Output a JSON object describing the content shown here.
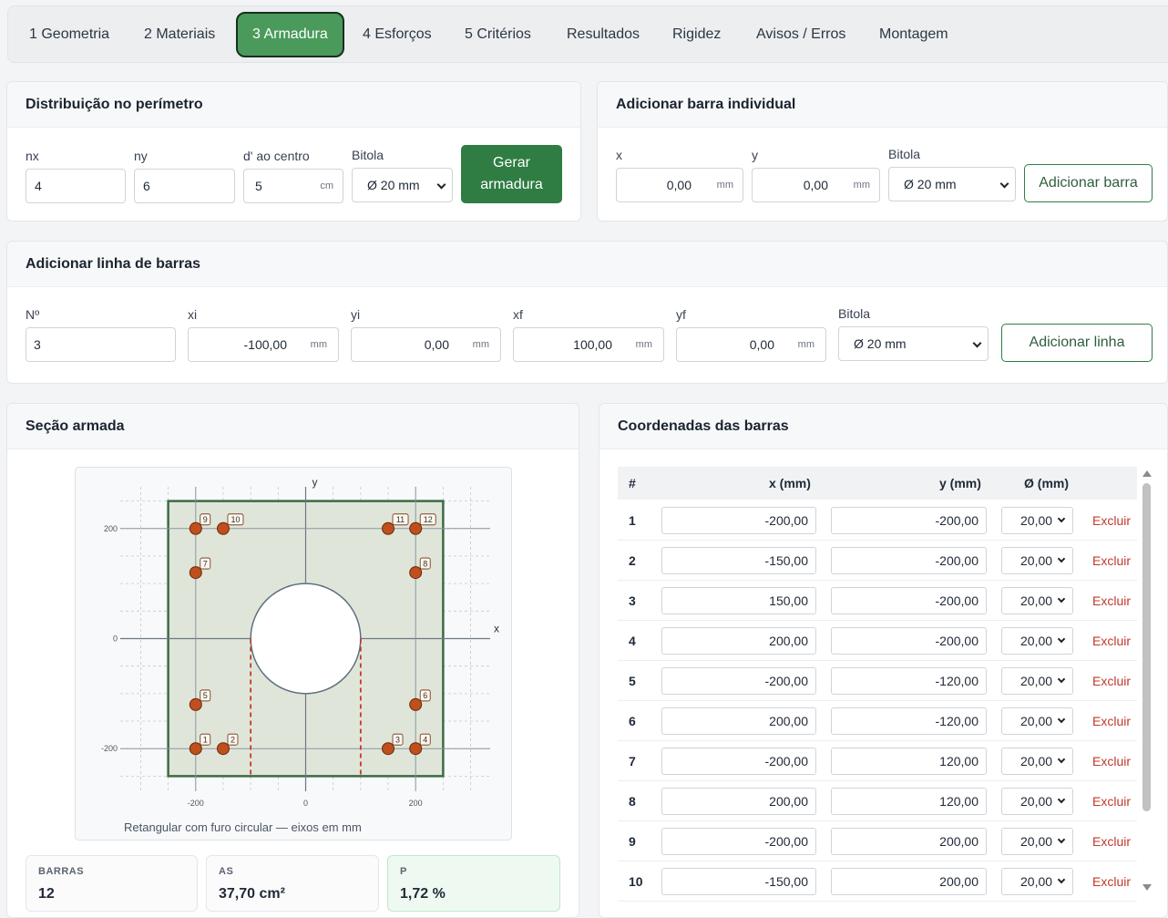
{
  "tabs": [
    {
      "label": "1 Geometria"
    },
    {
      "label": "2 Materiais"
    },
    {
      "label": "3 Armadura"
    },
    {
      "label": "4 Esforços"
    },
    {
      "label": "5 Critérios"
    },
    {
      "label": "Resultados"
    },
    {
      "label": "Rigidez"
    },
    {
      "label": "Avisos / Erros"
    },
    {
      "label": "Montagem"
    }
  ],
  "perimeter": {
    "title": "Distribuição no perímetro",
    "nx_label": "nx",
    "nx_value": "4",
    "ny_label": "ny",
    "ny_value": "6",
    "d_label": "d' ao centro",
    "d_value": "5",
    "d_unit": "cm",
    "bitola_label": "Bitola",
    "bitola_value": "Ø 20 mm",
    "button_line1": "Gerar",
    "button_line2": "armadura"
  },
  "single_bar": {
    "title": "Adicionar barra individual",
    "x_label": "x",
    "x_value": "0,00",
    "x_unit": "mm",
    "y_label": "y",
    "y_value": "0,00",
    "y_unit": "mm",
    "bitola_label": "Bitola",
    "bitola_value": "Ø 20 mm",
    "button": "Adicionar barra"
  },
  "bar_line": {
    "title": "Adicionar linha de barras",
    "n_label": "Nº",
    "n_value": "3",
    "xi_label": "xi",
    "xi_value": "-100,00",
    "xi_unit": "mm",
    "yi_label": "yi",
    "yi_value": "0,00",
    "yi_unit": "mm",
    "xf_label": "xf",
    "xf_value": "100,00",
    "xf_unit": "mm",
    "yf_label": "yf",
    "yf_value": "0,00",
    "yf_unit": "mm",
    "bitola_label": "Bitola",
    "bitola_value": "Ø 20 mm",
    "button": "Adicionar linha"
  },
  "section": {
    "title": "Seção armada",
    "axis_x": "x",
    "axis_y": "y",
    "x_ticks": [
      "-200",
      "0",
      "200"
    ],
    "y_ticks": [
      "200",
      "0",
      "-200"
    ],
    "caption": "Retangular com furo circular — eixos em mm",
    "colors": {
      "concrete_fill": "#dfe6d9",
      "outline": "#3d6b45",
      "bar": "#bf4f1c",
      "hole_edge": "#c0392b"
    }
  },
  "stats": {
    "bars_label": "BARRAS",
    "bars_value": "12",
    "as_label": "AS",
    "as_value": "37,70 cm²",
    "rho_label": "Ρ",
    "rho_value": "1,72 %"
  },
  "coords": {
    "title": "Coordenadas das barras",
    "headers": {
      "num": "#",
      "x": "x (mm)",
      "y": "y (mm)",
      "d": "Ø (mm)"
    },
    "delete_label": "Excluir",
    "rows": [
      {
        "num": "1",
        "x": "-200,00",
        "y": "-200,00",
        "d": "20,00"
      },
      {
        "num": "2",
        "x": "-150,00",
        "y": "-200,00",
        "d": "20,00"
      },
      {
        "num": "3",
        "x": "150,00",
        "y": "-200,00",
        "d": "20,00"
      },
      {
        "num": "4",
        "x": "200,00",
        "y": "-200,00",
        "d": "20,00"
      },
      {
        "num": "5",
        "x": "-200,00",
        "y": "-120,00",
        "d": "20,00"
      },
      {
        "num": "6",
        "x": "200,00",
        "y": "-120,00",
        "d": "20,00"
      },
      {
        "num": "7",
        "x": "-200,00",
        "y": "120,00",
        "d": "20,00"
      },
      {
        "num": "8",
        "x": "200,00",
        "y": "120,00",
        "d": "20,00"
      },
      {
        "num": "9",
        "x": "-200,00",
        "y": "200,00",
        "d": "20,00"
      },
      {
        "num": "10",
        "x": "-150,00",
        "y": "200,00",
        "d": "20,00"
      }
    ]
  },
  "bars_plot": [
    {
      "n": "1",
      "x": -200,
      "y": -200
    },
    {
      "n": "2",
      "x": -150,
      "y": -200
    },
    {
      "n": "3",
      "x": 150,
      "y": -200
    },
    {
      "n": "4",
      "x": 200,
      "y": -200
    },
    {
      "n": "5",
      "x": -200,
      "y": -120
    },
    {
      "n": "6",
      "x": 200,
      "y": -120
    },
    {
      "n": "7",
      "x": -200,
      "y": 120
    },
    {
      "n": "8",
      "x": 200,
      "y": 120
    },
    {
      "n": "9",
      "x": -200,
      "y": 200
    },
    {
      "n": "10",
      "x": -150,
      "y": 200
    },
    {
      "n": "11",
      "x": 150,
      "y": 200
    },
    {
      "n": "12",
      "x": 200,
      "y": 200
    }
  ]
}
